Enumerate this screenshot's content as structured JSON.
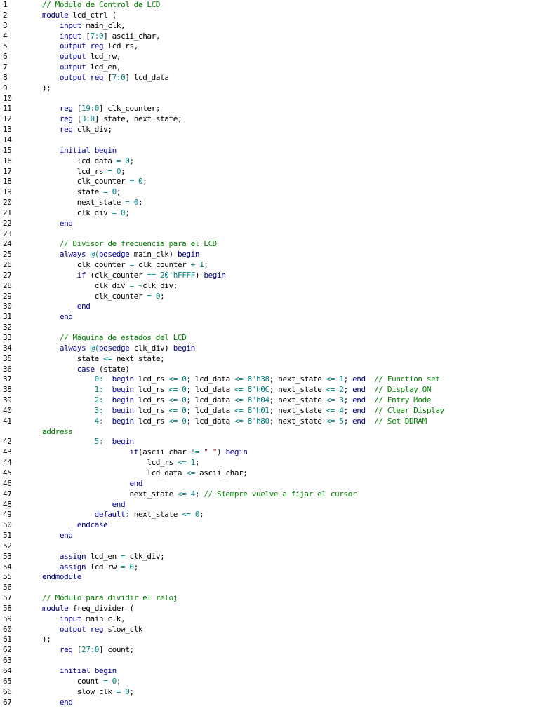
{
  "editor": {
    "lines": [
      {
        "no": "1",
        "text": "// Módulo de Control de LCD"
      },
      {
        "no": "2",
        "text": "module lcd_ctrl ("
      },
      {
        "no": "3",
        "text": "    input main_clk,"
      },
      {
        "no": "4",
        "text": "    input [7:0] ascii_char,"
      },
      {
        "no": "5",
        "text": "    output reg lcd_rs,"
      },
      {
        "no": "6",
        "text": "    output lcd_rw,"
      },
      {
        "no": "7",
        "text": "    output lcd_en,"
      },
      {
        "no": "8",
        "text": "    output reg [7:0] lcd_data"
      },
      {
        "no": "9",
        "text": ");"
      },
      {
        "no": "10",
        "text": ""
      },
      {
        "no": "11",
        "text": "    reg [19:0] clk_counter;"
      },
      {
        "no": "12",
        "text": "    reg [3:0] state, next_state;"
      },
      {
        "no": "13",
        "text": "    reg clk_div;"
      },
      {
        "no": "14",
        "text": ""
      },
      {
        "no": "15",
        "text": "    initial begin"
      },
      {
        "no": "16",
        "text": "        lcd_data = 0;"
      },
      {
        "no": "17",
        "text": "        lcd_rs = 0;"
      },
      {
        "no": "18",
        "text": "        clk_counter = 0;"
      },
      {
        "no": "19",
        "text": "        state = 0;"
      },
      {
        "no": "20",
        "text": "        next_state = 0;"
      },
      {
        "no": "21",
        "text": "        clk_div = 0;"
      },
      {
        "no": "22",
        "text": "    end"
      },
      {
        "no": "23",
        "text": ""
      },
      {
        "no": "24",
        "text": "    // Divisor de frecuencia para el LCD"
      },
      {
        "no": "25",
        "text": "    always @(posedge main_clk) begin"
      },
      {
        "no": "26",
        "text": "        clk_counter = clk_counter + 1;"
      },
      {
        "no": "27",
        "text": "        if (clk_counter == 20'hFFFF) begin"
      },
      {
        "no": "28",
        "text": "            clk_div = ~clk_div;"
      },
      {
        "no": "29",
        "text": "            clk_counter = 0;"
      },
      {
        "no": "30",
        "text": "        end"
      },
      {
        "no": "31",
        "text": "    end"
      },
      {
        "no": "32",
        "text": ""
      },
      {
        "no": "33",
        "text": "    // Máquina de estados del LCD"
      },
      {
        "no": "34",
        "text": "    always @(posedge clk_div) begin"
      },
      {
        "no": "35",
        "text": "        state <= next_state;"
      },
      {
        "no": "36",
        "text": "        case (state)"
      },
      {
        "no": "37",
        "text": "            0:  begin lcd_rs <= 0; lcd_data <= 8'h38; next_state <= 1; end  // Function set"
      },
      {
        "no": "38",
        "text": "            1:  begin lcd_rs <= 0; lcd_data <= 8'h0C; next_state <= 2; end  // Display ON"
      },
      {
        "no": "39",
        "text": "            2:  begin lcd_rs <= 0; lcd_data <= 8'h04; next_state <= 3; end  // Entry Mode"
      },
      {
        "no": "40",
        "text": "            3:  begin lcd_rs <= 0; lcd_data <= 8'h01; next_state <= 4; end  // Clear Display"
      },
      {
        "no": "41",
        "text": "            4:  begin lcd_rs <= 0; lcd_data <= 8'h80; next_state <= 5; end  // Set DDRAM"
      },
      {
        "no": "",
        "text": "address",
        "wrap": true
      },
      {
        "no": "42",
        "text": "            5:  begin"
      },
      {
        "no": "43",
        "text": "                    if(ascii_char != \" \") begin"
      },
      {
        "no": "44",
        "text": "                        lcd_rs <= 1;"
      },
      {
        "no": "45",
        "text": "                        lcd_data <= ascii_char;"
      },
      {
        "no": "46",
        "text": "                    end"
      },
      {
        "no": "47",
        "text": "                    next_state <= 4; // Siempre vuelve a fijar el cursor"
      },
      {
        "no": "48",
        "text": "                end"
      },
      {
        "no": "49",
        "text": "            default: next_state <= 0;"
      },
      {
        "no": "50",
        "text": "        endcase"
      },
      {
        "no": "51",
        "text": "    end"
      },
      {
        "no": "52",
        "text": ""
      },
      {
        "no": "53",
        "text": "    assign lcd_en = clk_div;"
      },
      {
        "no": "54",
        "text": "    assign lcd_rw = 0;"
      },
      {
        "no": "55",
        "text": "endmodule"
      },
      {
        "no": "56",
        "text": ""
      },
      {
        "no": "57",
        "text": "// Módulo para dividir el reloj"
      },
      {
        "no": "58",
        "text": "module freq_divider ("
      },
      {
        "no": "59",
        "text": "    input main_clk,"
      },
      {
        "no": "60",
        "text": "    output reg slow_clk"
      },
      {
        "no": "61",
        "text": ");"
      },
      {
        "no": "62",
        "text": "    reg [27:0] count;"
      },
      {
        "no": "63",
        "text": ""
      },
      {
        "no": "64",
        "text": "    initial begin"
      },
      {
        "no": "65",
        "text": "        count = 0;"
      },
      {
        "no": "66",
        "text": "        slow_clk = 0;"
      },
      {
        "no": "67",
        "text": "    end"
      }
    ]
  },
  "colors": {
    "keyword": "#00008b",
    "comment": "#008000",
    "number": "#008080",
    "string": "#a31515",
    "text": "#000000",
    "background": "#ffffff"
  }
}
